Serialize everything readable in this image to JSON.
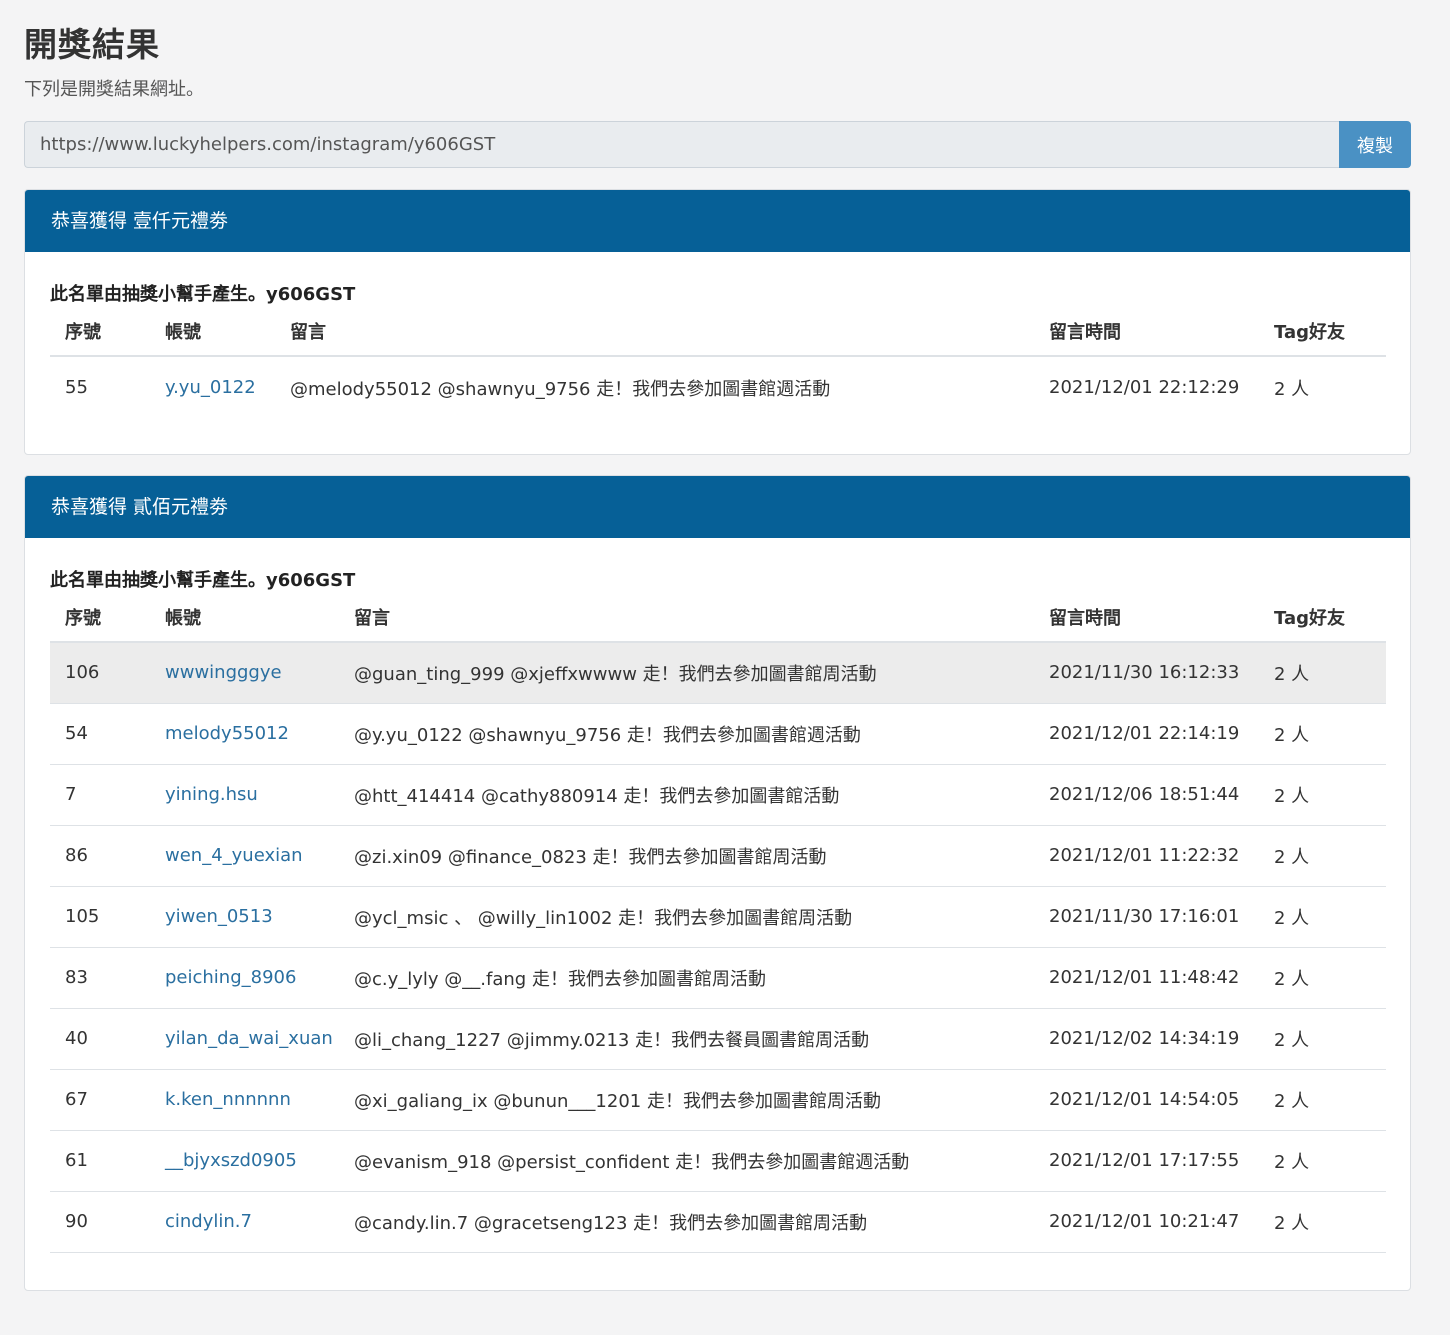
{
  "page": {
    "title": "開獎結果",
    "subtitle": "下列是開獎結果網址。"
  },
  "url_bar": {
    "value": "https://www.luckyhelpers.com/instagram/y606GST",
    "copy_label": "複製"
  },
  "columns": {
    "no": "序號",
    "account": "帳號",
    "comment": "留言",
    "time": "留言時間",
    "tag": "Tag好友"
  },
  "prizes": [
    {
      "header": "恭喜獲得 壹仟元禮劵",
      "note_prefix": "此名單由抽獎小幫手產生。",
      "note_code": "y606GST",
      "rows": [
        {
          "no": "55",
          "account": "y.yu_0122",
          "comment": "@melody55012 @shawnyu_9756 走！我們去參加圖書館週活動",
          "time": "2021/12/01 22:12:29",
          "tag": "2 人"
        }
      ]
    },
    {
      "header": "恭喜獲得 貳佰元禮劵",
      "note_prefix": "此名單由抽獎小幫手產生。",
      "note_code": "y606GST",
      "rows": [
        {
          "no": "106",
          "account": "wwwingggye",
          "comment": "@guan_ting_999 @xjeffxwwww 走！我們去參加圖書館周活動",
          "time": "2021/11/30 16:12:33",
          "tag": "2 人"
        },
        {
          "no": "54",
          "account": "melody55012",
          "comment": "@y.yu_0122 @shawnyu_9756 走！我們去參加圖書館週活動",
          "time": "2021/12/01 22:14:19",
          "tag": "2 人"
        },
        {
          "no": "7",
          "account": "yining.hsu",
          "comment": "@htt_414414 @cathy880914 走！我們去參加圖書館活動",
          "time": "2021/12/06 18:51:44",
          "tag": "2 人"
        },
        {
          "no": "86",
          "account": "wen_4_yuexian",
          "comment": "@zi.xin09 @finance_0823 走！我們去參加圖書館周活動",
          "time": "2021/12/01 11:22:32",
          "tag": "2 人"
        },
        {
          "no": "105",
          "account": "yiwen_0513",
          "comment": "@ycl_msic 、 @willy_lin1002 走！我們去參加圖書館周活動",
          "time": "2021/11/30 17:16:01",
          "tag": "2 人"
        },
        {
          "no": "83",
          "account": "peiching_8906",
          "comment": "@c.y_lyly @__.fang 走！我們去參加圖書館周活動",
          "time": "2021/12/01 11:48:42",
          "tag": "2 人"
        },
        {
          "no": "40",
          "account": "yilan_da_wai_xuan",
          "comment": "@li_chang_1227 @jimmy.0213 走！我們去餐員圖書館周活動",
          "time": "2021/12/02 14:34:19",
          "tag": "2 人"
        },
        {
          "no": "67",
          "account": "k.ken_nnnnnn",
          "comment": "@xi_galiang_ix @bunun___1201 走！我們去參加圖書館周活動",
          "time": "2021/12/01 14:54:05",
          "tag": "2 人"
        },
        {
          "no": "61",
          "account": "__bjyxszd0905",
          "comment": "@evanism_918 @persist_confident 走！我們去參加圖書館週活動",
          "time": "2021/12/01 17:17:55",
          "tag": "2 人"
        },
        {
          "no": "90",
          "account": "cindylin.7",
          "comment": "@candy.lin.7 @gracetseng123 走！我們去參加圖書館周活動",
          "time": "2021/12/01 10:21:47",
          "tag": "2 人"
        }
      ]
    }
  ],
  "colors": {
    "header_bg": "#066097",
    "copy_button": "#4a91c4",
    "link": "#2a6fa0",
    "highlight_row": "#ececec"
  }
}
